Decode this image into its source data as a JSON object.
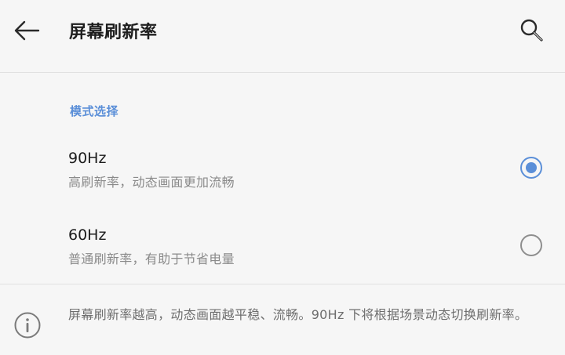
{
  "header": {
    "back_icon": "arrow-left-icon",
    "title": "屏幕刷新率",
    "search_icon": "search-icon"
  },
  "section": {
    "label": "模式选择"
  },
  "options": [
    {
      "title": "90Hz",
      "subtitle": "高刷新率，动态画面更加流畅",
      "selected": true
    },
    {
      "title": "60Hz",
      "subtitle": "普通刷新率，有助于节省电量",
      "selected": false
    }
  ],
  "info": {
    "icon": "info-icon",
    "text": "屏幕刷新率越高，动态画面越平稳、流畅。90Hz 下将根据场景动态切换刷新率。"
  },
  "colors": {
    "accent": "#5b8fd8",
    "background": "#f6f6f6",
    "secondary_text": "#8a8a8a"
  }
}
